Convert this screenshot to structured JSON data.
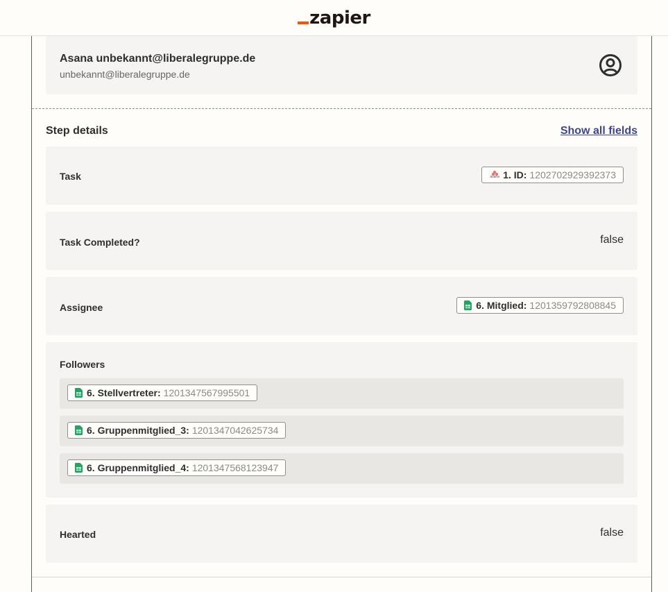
{
  "header": {
    "logo_text": "zapier"
  },
  "account": {
    "name": "Asana unbekannt@liberalegruppe.de",
    "email": "unbekannt@liberalegruppe.de"
  },
  "step_details": {
    "title": "Step details",
    "show_all_label": "Show all fields"
  },
  "fields": {
    "task": {
      "label": "Task",
      "pill_key": "1. ID:",
      "pill_value": "1202702929392373",
      "app_icon_text": "asana"
    },
    "task_completed": {
      "label": "Task Completed?",
      "value": "false"
    },
    "assignee": {
      "label": "Assignee",
      "pill_key": "6. Mitglied:",
      "pill_value": "1201359792808845"
    },
    "followers": {
      "label": "Followers",
      "items": [
        {
          "key": "6. Stellvertreter:",
          "value": "1201347567995501"
        },
        {
          "key": "6. Gruppenmitglied_3:",
          "value": "1201347042625734"
        },
        {
          "key": "6. Gruppenmitglied_4:",
          "value": "1201347568123947"
        }
      ]
    },
    "hearted": {
      "label": "Hearted",
      "value": "false"
    }
  },
  "colors": {
    "brand_orange": "#ff4f00",
    "link_blue": "#3d4592",
    "sheets_green": "#21a464",
    "asana_coral": "#f06a6a"
  }
}
